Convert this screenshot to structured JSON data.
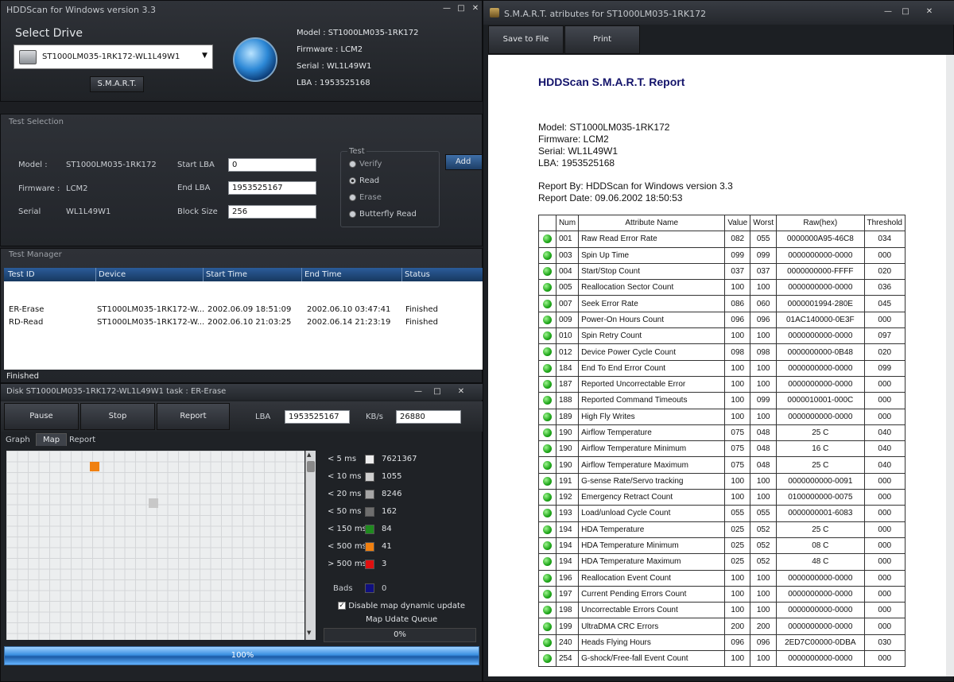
{
  "main_window": {
    "title": "HDDScan for Windows version 3.3",
    "select_drive_label": "Select Drive",
    "drive_selected": "ST1000LM035-1RK172-WL1L49W1",
    "smart_button": "S.M.A.R.T.",
    "info": {
      "model": "Model : ST1000LM035-1RK172",
      "firmware": "Firmware : LCM2",
      "serial": "Serial : WL1L49W1",
      "lba": "LBA : 1953525168"
    }
  },
  "test_selection": {
    "header": "Test Selection",
    "model_label": "Model :",
    "model_value": "ST1000LM035-1RK172",
    "firmware_label": "Firmware :",
    "firmware_value": "LCM2",
    "serial_label": "Serial",
    "serial_value": "WL1L49W1",
    "start_lba_label": "Start LBA",
    "start_lba_value": "0",
    "end_lba_label": "End LBA",
    "end_lba_value": "1953525167",
    "block_size_label": "Block Size",
    "block_size_value": "256",
    "test_group_label": "Test",
    "options": [
      "Verify",
      "Read",
      "Erase",
      "Butterfly Read"
    ],
    "selected_option": "Read",
    "add_test_button": "Add Tes"
  },
  "test_manager": {
    "header": "Test Manager",
    "columns": [
      "Test ID",
      "Device",
      "Start Time",
      "End Time",
      "Status"
    ],
    "rows": [
      {
        "id": "ER-Erase",
        "device": "ST1000LM035-1RK172-W...",
        "start": "2002.06.09 18:51:09",
        "end": "2002.06.10 03:47:41",
        "status": "Finished"
      },
      {
        "id": "RD-Read",
        "device": "ST1000LM035-1RK172-W...",
        "start": "2002.06.10 21:03:25",
        "end": "2002.06.14 21:23:19",
        "status": "Finished"
      }
    ],
    "status_bar": "Finished"
  },
  "task_window": {
    "title": "Disk ST1000LM035-1RK172-WL1L49W1   task : ER-Erase",
    "pause_button": "Pause",
    "stop_button": "Stop",
    "report_button": "Report",
    "lba_label": "LBA",
    "lba_value": "1953525167",
    "kbs_label": "KB/s",
    "kbs_value": "26880",
    "tabs": [
      "Graph",
      "Map",
      "Report"
    ],
    "active_tab": "Map",
    "legend": [
      {
        "label": "< 5 ms",
        "color": "#eeeeee",
        "count": "7621367"
      },
      {
        "label": "< 10 ms",
        "color": "#cfcfcf",
        "count": "1055"
      },
      {
        "label": "< 20 ms",
        "color": "#a6a6a6",
        "count": "8246"
      },
      {
        "label": "< 50 ms",
        "color": "#6e6e6e",
        "count": "162"
      },
      {
        "label": "< 150 ms",
        "color": "#1f8a1f",
        "count": "84"
      },
      {
        "label": "< 500 ms",
        "color": "#f08010",
        "count": "41"
      },
      {
        "label": "> 500 ms",
        "color": "#e01010",
        "count": "3"
      }
    ],
    "bads_label": "Bads",
    "bads_color": "#101080",
    "bads_count": "0",
    "disable_map_label": "Disable map dynamic update",
    "queue_label": "Map Udate Queue",
    "queue_value": "0%",
    "progress_text": "100%",
    "progress": 1.0
  },
  "smart_window": {
    "title": "S.M.A.R.T. atributes for ST1000LM035-1RK172",
    "save_button": "Save to File",
    "print_button": "Print",
    "report_title": "HDDScan S.M.A.R.T. Report",
    "model_line": "Model: ST1000LM035-1RK172",
    "firmware_line": "Firmware: LCM2",
    "serial_line": "Serial: WL1L49W1",
    "lba_line": "LBA: 1953525168",
    "report_by": "Report By: HDDScan for Windows version 3.3",
    "report_date": "Report Date: 09.06.2002 18:50:53",
    "columns": [
      "Num",
      "Attribute Name",
      "Value",
      "Worst",
      "Raw(hex)",
      "Threshold"
    ],
    "rows": [
      [
        "001",
        "Raw Read Error Rate",
        "082",
        "055",
        "0000000A95-46C8",
        "034"
      ],
      [
        "003",
        "Spin Up Time",
        "099",
        "099",
        "0000000000-0000",
        "000"
      ],
      [
        "004",
        "Start/Stop Count",
        "037",
        "037",
        "0000000000-FFFF",
        "020"
      ],
      [
        "005",
        "Reallocation Sector Count",
        "100",
        "100",
        "0000000000-0000",
        "036"
      ],
      [
        "007",
        "Seek Error Rate",
        "086",
        "060",
        "0000001994-280E",
        "045"
      ],
      [
        "009",
        "Power-On Hours Count",
        "096",
        "096",
        "01AC140000-0E3F",
        "000"
      ],
      [
        "010",
        "Spin Retry Count",
        "100",
        "100",
        "0000000000-0000",
        "097"
      ],
      [
        "012",
        "Device Power Cycle Count",
        "098",
        "098",
        "0000000000-0B48",
        "020"
      ],
      [
        "184",
        "End To End Error Count",
        "100",
        "100",
        "0000000000-0000",
        "099"
      ],
      [
        "187",
        "Reported Uncorrectable Error",
        "100",
        "100",
        "0000000000-0000",
        "000"
      ],
      [
        "188",
        "Reported Command Timeouts",
        "100",
        "099",
        "0000010001-000C",
        "000"
      ],
      [
        "189",
        "High Fly Writes",
        "100",
        "100",
        "0000000000-0000",
        "000"
      ],
      [
        "190",
        "Airflow Temperature",
        "075",
        "048",
        "25 C",
        "040"
      ],
      [
        "190",
        "Airflow Temperature Minimum",
        "075",
        "048",
        "16 C",
        "040"
      ],
      [
        "190",
        "Airflow Temperature Maximum",
        "075",
        "048",
        "25 C",
        "040"
      ],
      [
        "191",
        "G-sense Rate/Servo tracking",
        "100",
        "100",
        "0000000000-0091",
        "000"
      ],
      [
        "192",
        "Emergency Retract Count",
        "100",
        "100",
        "0100000000-0075",
        "000"
      ],
      [
        "193",
        "Load/unload Cycle Count",
        "055",
        "055",
        "0000000001-6083",
        "000"
      ],
      [
        "194",
        "HDA Temperature",
        "025",
        "052",
        "25 C",
        "000"
      ],
      [
        "194",
        "HDA Temperature Minimum",
        "025",
        "052",
        "08 C",
        "000"
      ],
      [
        "194",
        "HDA Temperature Maximum",
        "025",
        "052",
        "48 C",
        "000"
      ],
      [
        "196",
        "Reallocation Event Count",
        "100",
        "100",
        "0000000000-0000",
        "000"
      ],
      [
        "197",
        "Current Pending Errors Count",
        "100",
        "100",
        "0000000000-0000",
        "000"
      ],
      [
        "198",
        "Uncorrectable Errors Count",
        "100",
        "100",
        "0000000000-0000",
        "000"
      ],
      [
        "199",
        "UltraDMA CRC Errors",
        "200",
        "200",
        "0000000000-0000",
        "000"
      ],
      [
        "240",
        "Heads Flying Hours",
        "096",
        "096",
        "2ED7C00000-0DBA",
        "030"
      ],
      [
        "254",
        "G-shock/Free-fall Event Count",
        "100",
        "100",
        "0000000000-0000",
        "000"
      ]
    ]
  }
}
